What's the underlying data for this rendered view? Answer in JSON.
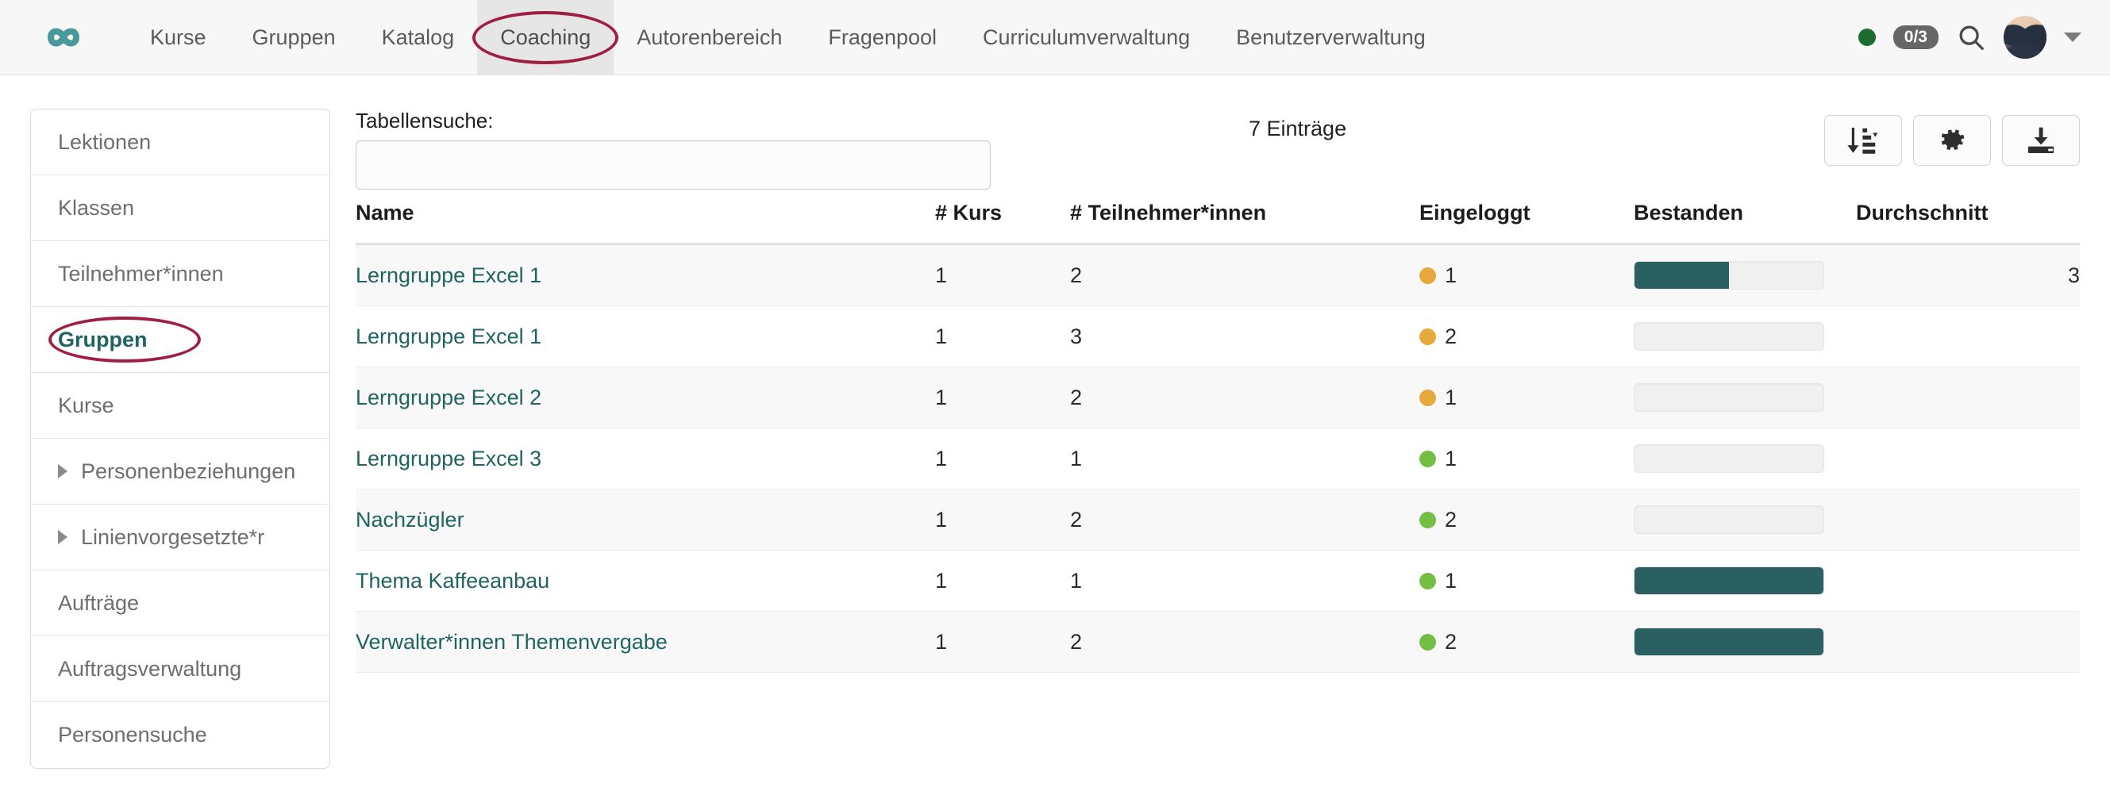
{
  "header": {
    "logo_icon": "infinity-logo",
    "logo_color": "#479a99",
    "nav_items": [
      {
        "label": "Kurse",
        "active": false
      },
      {
        "label": "Gruppen",
        "active": false
      },
      {
        "label": "Katalog",
        "active": false
      },
      {
        "label": "Coaching",
        "active": true
      },
      {
        "label": "Autorenbereich",
        "active": false
      },
      {
        "label": "Fragenpool",
        "active": false
      },
      {
        "label": "Curriculumverwaltung",
        "active": false
      },
      {
        "label": "Benutzerverwaltung",
        "active": false
      }
    ],
    "status_dot_color": "#1d6b2e",
    "count_badge": "0/3",
    "search_icon": "search-icon",
    "avatar_icon": "user-avatar",
    "caret_icon": "chevron-down-icon",
    "annotation_color": "#9e1f41"
  },
  "sidebar": {
    "items": [
      {
        "label": "Lektionen",
        "expandable": false,
        "active": false
      },
      {
        "label": "Klassen",
        "expandable": false,
        "active": false
      },
      {
        "label": "Teilnehmer*innen",
        "expandable": false,
        "active": false
      },
      {
        "label": "Gruppen",
        "expandable": false,
        "active": true
      },
      {
        "label": "Kurse",
        "expandable": false,
        "active": false
      },
      {
        "label": "Personenbeziehungen",
        "expandable": true,
        "active": false
      },
      {
        "label": "Linienvorgesetzte*r",
        "expandable": true,
        "active": false
      },
      {
        "label": "Aufträge",
        "expandable": false,
        "active": false
      },
      {
        "label": "Auftragsverwaltung",
        "expandable": false,
        "active": false
      },
      {
        "label": "Personensuche",
        "expandable": false,
        "active": false
      }
    ]
  },
  "toolbar": {
    "search_label": "Tabellensuche:",
    "search_value": "",
    "search_placeholder": "",
    "entry_count": "7 Einträge",
    "buttons": [
      {
        "name": "sort-button",
        "icon": "sort-amount-down-icon"
      },
      {
        "name": "settings-button",
        "icon": "gear-icon"
      },
      {
        "name": "download-button",
        "icon": "download-icon"
      }
    ]
  },
  "table": {
    "columns": [
      "Name",
      "# Kurs",
      "# Teilnehmer*innen",
      "Eingeloggt",
      "Bestanden",
      "Durchschnitt"
    ],
    "rows": [
      {
        "name": "Lerngruppe Excel 1",
        "kurs": "1",
        "teilnehmer": "2",
        "eingeloggt_count": "1",
        "eingeloggt_status": "amber",
        "bestanden_percent": 50,
        "durchschnitt": "3"
      },
      {
        "name": "Lerngruppe Excel 1",
        "kurs": "1",
        "teilnehmer": "3",
        "eingeloggt_count": "2",
        "eingeloggt_status": "amber",
        "bestanden_percent": 0,
        "durchschnitt": ""
      },
      {
        "name": "Lerngruppe Excel 2",
        "kurs": "1",
        "teilnehmer": "2",
        "eingeloggt_count": "1",
        "eingeloggt_status": "amber",
        "bestanden_percent": 0,
        "durchschnitt": ""
      },
      {
        "name": "Lerngruppe Excel 3",
        "kurs": "1",
        "teilnehmer": "1",
        "eingeloggt_count": "1",
        "eingeloggt_status": "green",
        "bestanden_percent": 0,
        "durchschnitt": ""
      },
      {
        "name": "Nachzügler",
        "kurs": "1",
        "teilnehmer": "2",
        "eingeloggt_count": "2",
        "eingeloggt_status": "green",
        "bestanden_percent": 0,
        "durchschnitt": ""
      },
      {
        "name": "Thema Kaffeeanbau",
        "kurs": "1",
        "teilnehmer": "1",
        "eingeloggt_count": "1",
        "eingeloggt_status": "green",
        "bestanden_percent": 100,
        "durchschnitt": ""
      },
      {
        "name": "Verwalter*innen Themenvergabe",
        "kurs": "1",
        "teilnehmer": "2",
        "eingeloggt_count": "2",
        "eingeloggt_status": "green",
        "bestanden_percent": 100,
        "durchschnitt": ""
      }
    ]
  },
  "colors": {
    "brand_teal": "#1f6463",
    "progress_fill": "#2a6062",
    "status_amber": "#e8a93c",
    "status_green": "#72bf44",
    "annotation_red": "#9e1f41"
  }
}
